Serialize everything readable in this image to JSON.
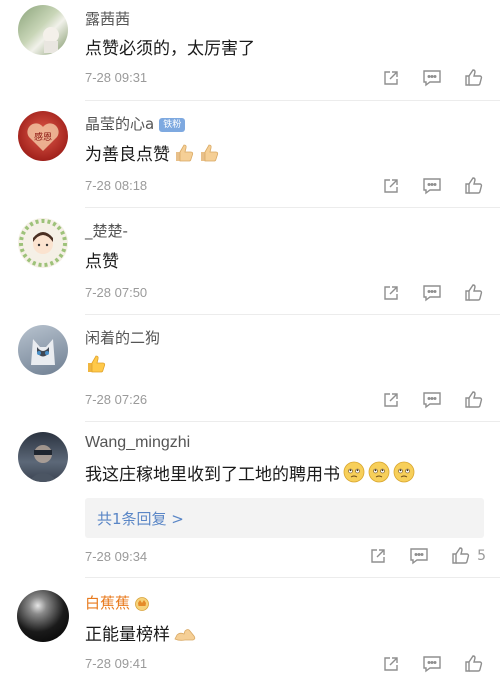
{
  "comments": [
    {
      "user": "露茜茜",
      "text": "点赞必须的，太厉害了",
      "time": "7-28 09:31"
    },
    {
      "user": "晶莹的心a",
      "badge": "铁粉",
      "text": "为善良点赞",
      "time": "7-28 08:18"
    },
    {
      "user": "_楚楚-",
      "text": "点赞",
      "time": "7-28 07:50"
    },
    {
      "user": "闲着的二狗",
      "text": "",
      "time": "7-28 07:26"
    },
    {
      "user": "Wang_mingzhi",
      "text": "我这庄稼地里收到了工地的聘用书",
      "time": "7-28 09:34",
      "reply_label": "共1条回复 >",
      "like_count": "5"
    },
    {
      "user": "白蕉蕉",
      "text": "正能量榜样",
      "time": "7-28 09:41"
    }
  ],
  "icons": {
    "share": "share-icon",
    "comment": "comment-icon",
    "like": "like-icon"
  },
  "colors": {
    "link": "#5a86c6",
    "orange_name": "#e87a1d",
    "fan_badge": "#7ea9e0"
  }
}
